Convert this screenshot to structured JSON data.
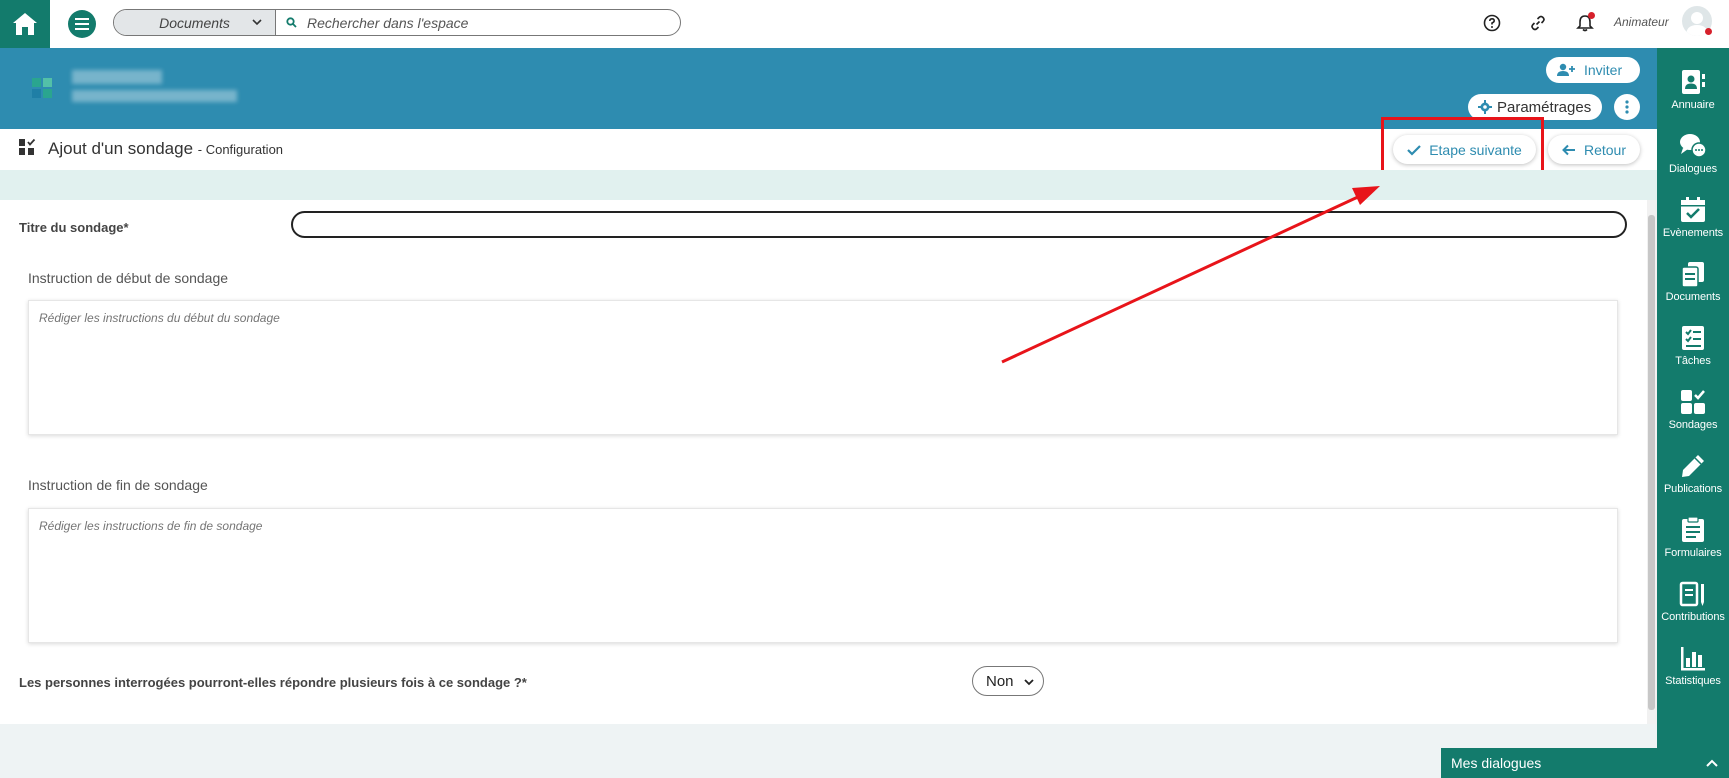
{
  "topbar": {
    "search_scope": "Documents",
    "search_placeholder": "Rechercher dans l'espace",
    "user_role": "Animateur"
  },
  "banner": {
    "invite_label": "Inviter",
    "settings_label": "Paramétrages"
  },
  "page": {
    "title": "Ajout d'un sondage",
    "subtitle": "- Configuration",
    "next_label": "Etape suivante",
    "back_label": "Retour"
  },
  "form": {
    "title_label": "Titre du sondage*",
    "title_value": "",
    "start_label": "Instruction de début de sondage",
    "start_placeholder": "Rédiger les instructions du début du sondage",
    "end_label": "Instruction de fin de sondage",
    "end_placeholder": "Rédiger les instructions de fin de sondage",
    "multi_label": "Les personnes interrogées pourront-elles répondre plusieurs fois à ce sondage ?*",
    "multi_value": "Non"
  },
  "sidebar": {
    "items": [
      {
        "label": "Annuaire",
        "icon": "contacts-icon"
      },
      {
        "label": "Dialogues",
        "icon": "chat-icon"
      },
      {
        "label": "Evènements",
        "icon": "calendar-check-icon"
      },
      {
        "label": "Documents",
        "icon": "documents-icon"
      },
      {
        "label": "Tâches",
        "icon": "tasks-icon"
      },
      {
        "label": "Sondages",
        "icon": "polls-icon"
      },
      {
        "label": "Publications",
        "icon": "pencil-icon"
      },
      {
        "label": "Formulaires",
        "icon": "form-icon"
      },
      {
        "label": "Contributions",
        "icon": "contributions-icon"
      },
      {
        "label": "Statistiques",
        "icon": "stats-icon"
      }
    ]
  },
  "dialog_bar": {
    "label": "Mes dialogues"
  },
  "colors": {
    "primary": "#137b6c",
    "banner": "#2e8cb0",
    "highlight": "#e8141a"
  }
}
